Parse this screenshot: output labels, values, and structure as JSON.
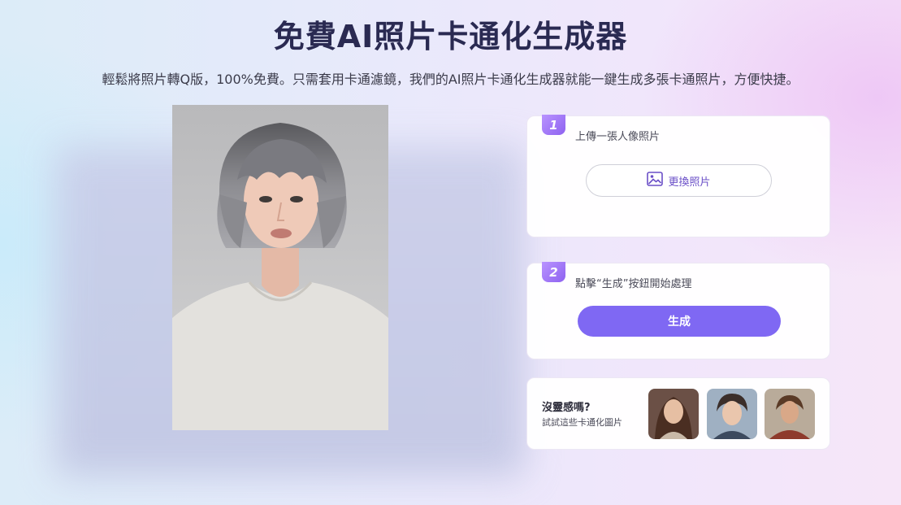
{
  "header": {
    "title": "免費AI照片卡通化生成器",
    "subtitle": "輕鬆將照片轉Q版，100%免費。只需套用卡通濾鏡，我們的AI照片卡通化生成器就能一鍵生成多張卡通照片，方便快捷。"
  },
  "steps": [
    {
      "number": "1",
      "label": "上傳一張人像照片",
      "button_label": "更換照片",
      "button_icon": "image-icon"
    },
    {
      "number": "2",
      "label": "點擊“生成”按鈕開始處理",
      "button_label": "生成"
    }
  ],
  "inspiration": {
    "title": "沒靈感嗎?",
    "subtitle": "試試這些卡通化圖片"
  },
  "colors": {
    "accent": "#7f68f3",
    "title": "#2a2a52",
    "badge": "#9b74f5"
  }
}
